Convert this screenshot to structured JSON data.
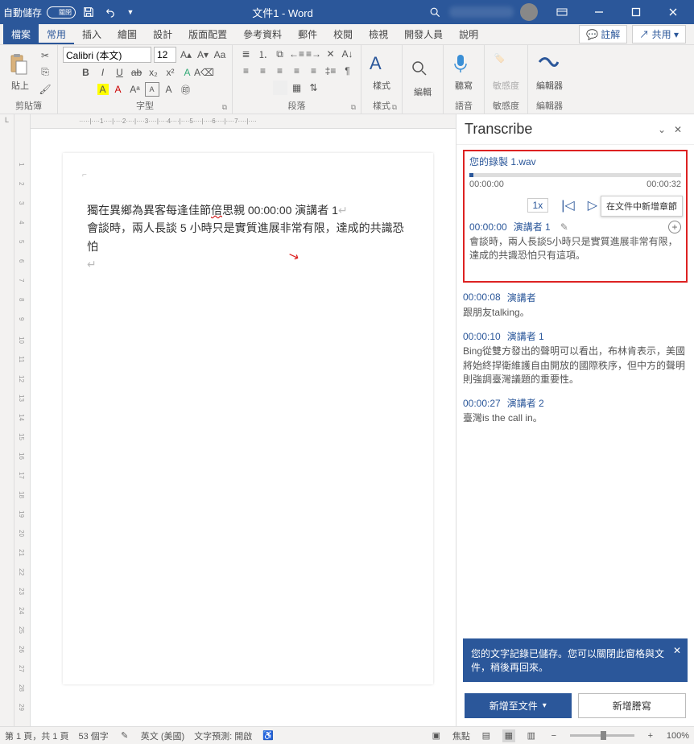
{
  "title": {
    "autosave_label": "自動儲存",
    "autosave_state": "關閉",
    "document": "文件1 - Word"
  },
  "menu": {
    "file": "檔案",
    "tabs": [
      "常用",
      "插入",
      "繪圖",
      "設計",
      "版面配置",
      "參考資料",
      "郵件",
      "校閱",
      "檢視",
      "開發人員",
      "說明"
    ],
    "comment_btn": "註解",
    "share_btn": "共用"
  },
  "ribbon": {
    "clipboard": {
      "paste": "貼上",
      "label": "剪貼簿"
    },
    "font": {
      "name": "Calibri (本文)",
      "size": "12",
      "label": "字型"
    },
    "paragraph": {
      "label": "段落"
    },
    "styles": {
      "btn": "樣式",
      "label": "樣式"
    },
    "editing": {
      "btn": "編輯",
      "label": ""
    },
    "voice": {
      "btn": "聽寫",
      "label": "語音"
    },
    "sensitivity": {
      "btn": "敏感度",
      "label": "敏感度"
    },
    "editor": {
      "btn": "編輯器",
      "label": "編輯器"
    }
  },
  "document_body": {
    "line1_a": "獨在異鄉為異客每逢佳節",
    "line1_b": "倍",
    "line1_c": "思親 00:00:00  演講者  1",
    "line2": "會談時，兩人長談 5 小時只是實質進展非常有限，達成的共識恐怕"
  },
  "panel": {
    "title": "Transcribe",
    "audio_name": "您的錄製 1.wav",
    "time_start": "00:00:00",
    "time_end": "00:00:32",
    "speed": "1x",
    "tooltip": "在文件中新增章節",
    "segments": [
      {
        "time": "00:00:00",
        "speaker": "演講者 1",
        "text": "會談時，兩人長談5小時只是實質進展非常有限，達成的共識恐怕只有這項。",
        "editable": true,
        "addable": true
      },
      {
        "time": "00:00:08",
        "speaker": "演講者",
        "text": "跟朋友talking。"
      },
      {
        "time": "00:00:10",
        "speaker": "演講者 1",
        "text": "Bing從雙方發出的聲明可以看出，布林肯表示，美國將始終捍衛維護自由開放的國際秩序，但中方的聲明則強調臺灣議題的重要性。"
      },
      {
        "time": "00:00:27",
        "speaker": "演講者 2",
        "text": "臺灣is the call in。"
      }
    ],
    "banner": "您的文字記錄已儲存。您可以關閉此窗格與文件，稍後再回來。",
    "btn_add": "新增至文件",
    "btn_new": "新增謄寫"
  },
  "status": {
    "page": "第 1 頁，共 1 頁",
    "words": "53 個字",
    "lang": "英文 (美國)",
    "predict": "文字預測: 開啟",
    "focus": "焦點",
    "zoom": "100%"
  },
  "ruler": {
    "h_marks": "·····|····1····|····2····|····3····|····4····|····5····|····6····|····7····|····",
    "v_marks": [
      "1",
      "2",
      "3",
      "4",
      "5",
      "6",
      "7",
      "8",
      "9",
      "10",
      "11",
      "12",
      "13",
      "14",
      "15",
      "16",
      "17",
      "18",
      "19",
      "20",
      "21",
      "22",
      "23",
      "24",
      "25",
      "26",
      "27",
      "28",
      "29"
    ],
    "h_tab": "L"
  }
}
